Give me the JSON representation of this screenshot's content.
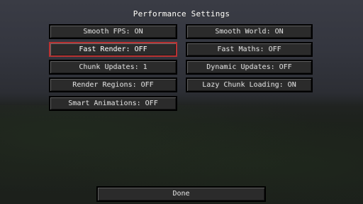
{
  "screen": {
    "title": "Performance Settings"
  },
  "buttons": {
    "smooth_fps": "Smooth FPS: ON",
    "smooth_world": "Smooth World: ON",
    "fast_render": "Fast Render: OFF",
    "fast_maths": "Fast Maths: OFF",
    "chunk_updates": "Chunk Updates: 1",
    "dynamic_updates": "Dynamic Updates: OFF",
    "render_regions": "Render Regions: OFF",
    "lazy_chunk_loading": "Lazy Chunk Loading: ON",
    "smart_animations": "Smart Animations: OFF",
    "done": "Done"
  },
  "colors": {
    "selected_border": "#b83232",
    "button_bg": "#2b2b2b",
    "text": "#e0e0e0"
  }
}
